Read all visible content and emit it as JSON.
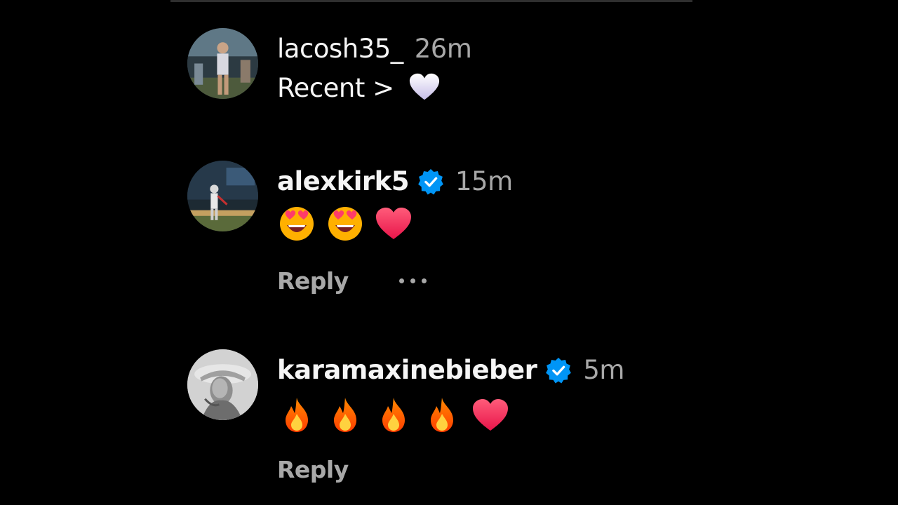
{
  "comments": [
    {
      "username": "lacosh35_",
      "verified": false,
      "time": "26m",
      "text": "Recent >",
      "emojis": [
        "white-heart-icon"
      ],
      "avatar": "stadium-photo-avatar"
    },
    {
      "username": "alexkirk5",
      "verified": true,
      "time": "15m",
      "text": "",
      "emojis": [
        "heart-eyes-icon",
        "heart-eyes-icon",
        "red-heart-icon"
      ],
      "reply_label": "Reply",
      "more_icon": "more-options-icon",
      "avatar": "baseball-player-avatar"
    },
    {
      "username": "karamaxinebieber",
      "verified": true,
      "time": "5m",
      "text": "",
      "emojis": [
        "fire-icon",
        "fire-icon",
        "fire-icon",
        "fire-icon",
        "red-heart-icon"
      ],
      "reply_label": "Reply",
      "avatar": "portrait-photo-avatar"
    }
  ],
  "colors": {
    "background": "#000000",
    "primary_text": "#f5f5f5",
    "secondary_text": "#a8a8a8",
    "verified_badge": "#0095f6"
  }
}
